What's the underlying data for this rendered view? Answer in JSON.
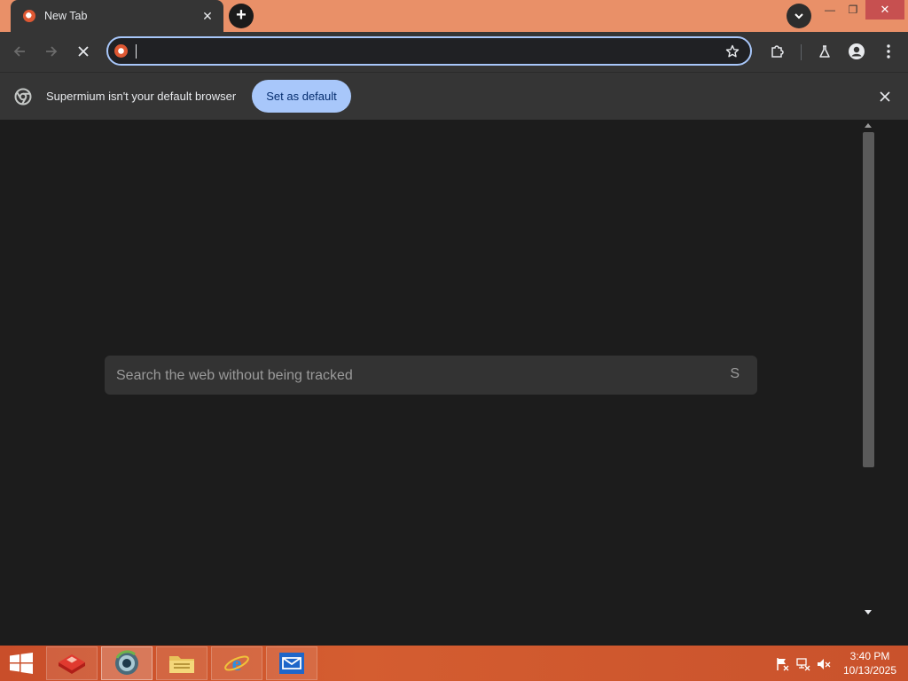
{
  "window": {
    "tab_title": "New Tab",
    "tab_close_glyph": "✕",
    "new_tab_glyph": "+",
    "minimize_glyph": "—",
    "maximize_glyph": "❐",
    "close_glyph": "✕",
    "tab_search_icon": "chevron-down-icon"
  },
  "toolbar": {
    "back_icon": "arrow-left-icon",
    "forward_icon": "arrow-right-icon",
    "stop_icon": "close-icon",
    "address_value": "",
    "site_icon": "duckduckgo-icon",
    "bookmark_icon": "star-icon",
    "extensions_icon": "puzzle-icon",
    "labs_icon": "flask-icon",
    "profile_icon": "person-icon",
    "menu_icon": "kebab-menu-icon"
  },
  "infobar": {
    "message": "Supermium isn't your default browser",
    "button_label": "Set as default",
    "close_icon": "close-icon"
  },
  "page": {
    "search_placeholder": "Search the web without being tracked",
    "search_button_glyph": "S"
  },
  "taskbar": {
    "items": [
      {
        "name": "start-button",
        "icon": "windows-logo-icon"
      },
      {
        "name": "app-1",
        "icon": "red-shapes-icon"
      },
      {
        "name": "browser",
        "icon": "supermium-icon",
        "active": true
      },
      {
        "name": "file-explorer",
        "icon": "folder-icon"
      },
      {
        "name": "internet-explorer",
        "icon": "ie-icon"
      },
      {
        "name": "mail",
        "icon": "mail-icon"
      }
    ],
    "tray_icons": [
      "flag-icon",
      "network-icon",
      "volume-muted-icon"
    ],
    "time": "3:40 PM",
    "date": "10/13/2025"
  },
  "colors": {
    "titlebar": "#e99068",
    "toolbar": "#353535",
    "accent": "#a8c7fa",
    "content_bg": "#1c1c1c",
    "taskbar": "#d45d30"
  }
}
